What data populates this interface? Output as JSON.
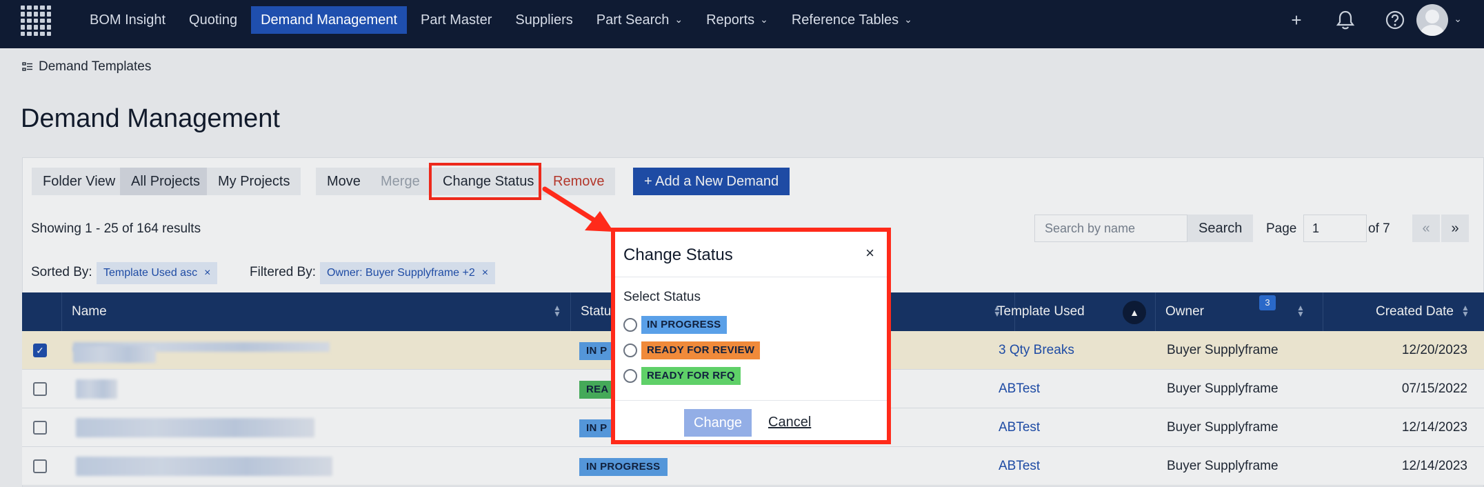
{
  "nav": {
    "items": [
      {
        "label": "BOM Insight",
        "active": false,
        "dropdown": false
      },
      {
        "label": "Quoting",
        "active": false,
        "dropdown": false
      },
      {
        "label": "Demand Management",
        "active": true,
        "dropdown": false
      },
      {
        "label": "Part Master",
        "active": false,
        "dropdown": false
      },
      {
        "label": "Suppliers",
        "active": false,
        "dropdown": false
      },
      {
        "label": "Part Search",
        "active": false,
        "dropdown": true
      },
      {
        "label": "Reports",
        "active": false,
        "dropdown": true
      },
      {
        "label": "Reference Tables",
        "active": false,
        "dropdown": true
      }
    ],
    "icons": [
      "plus-icon",
      "bell-icon",
      "help-icon",
      "avatar"
    ]
  },
  "breadcrumb": {
    "label": "Demand Templates"
  },
  "page": {
    "title": "Demand Management"
  },
  "toolbar": {
    "folder_view": "Folder View",
    "all_projects": "All Projects",
    "my_projects": "My Projects",
    "move": "Move",
    "merge": "Merge",
    "change_status": "Change Status",
    "remove": "Remove",
    "add_demand": "+ Add a New Demand"
  },
  "results": {
    "summary": "Showing 1 - 25 of 164 results"
  },
  "search": {
    "placeholder": "Search by name",
    "button": "Search"
  },
  "pager": {
    "label": "Page",
    "current": "1",
    "of": "of 7",
    "prev": "«",
    "next": "»"
  },
  "sort": {
    "label": "Sorted By:",
    "chip": "Template Used asc"
  },
  "filter": {
    "label": "Filtered By:",
    "chip": "Owner: Buyer Supplyframe +2",
    "count": "3"
  },
  "table": {
    "columns": [
      "Name",
      "Status",
      "",
      "Template Used",
      "Owner",
      "Created Date"
    ],
    "rows": [
      {
        "checked": true,
        "status": "IN PROGRESS",
        "status_visible": "IN P",
        "status_color": "#5aa0e8",
        "template": "3 Qty Breaks",
        "owner": "Buyer Supplyframe",
        "date": "12/20/2023"
      },
      {
        "checked": false,
        "status": "READY FOR REVIEW",
        "status_visible": "REA",
        "status_color": "#49b55d",
        "template": "ABTest",
        "owner": "Buyer Supplyframe",
        "date": "07/15/2022"
      },
      {
        "checked": false,
        "status": "IN PROGRESS",
        "status_visible": "IN P",
        "status_color": "#5aa0e8",
        "template": "ABTest",
        "owner": "Buyer Supplyframe",
        "date": "12/14/2023"
      },
      {
        "checked": false,
        "status": "IN PROGRESS",
        "status_visible": "IN PROGRESS",
        "status_color": "#5aa0e8",
        "template": "ABTest",
        "owner": "Buyer Supplyframe",
        "date": "12/14/2023"
      }
    ]
  },
  "modal": {
    "title": "Change Status",
    "close": "×",
    "select_label": "Select Status",
    "options": [
      {
        "label": "IN PROGRESS",
        "color": "#5aa0e8"
      },
      {
        "label": "READY FOR REVIEW",
        "color": "#f08a3a"
      },
      {
        "label": "READY FOR RFQ",
        "color": "#5fd068"
      }
    ],
    "change": "Change",
    "cancel": "Cancel"
  },
  "colors": {
    "nav_bg": "#0f1b33",
    "accent": "#1f4fae",
    "table_header": "#163466",
    "annotation_red": "#ff2a1a"
  }
}
